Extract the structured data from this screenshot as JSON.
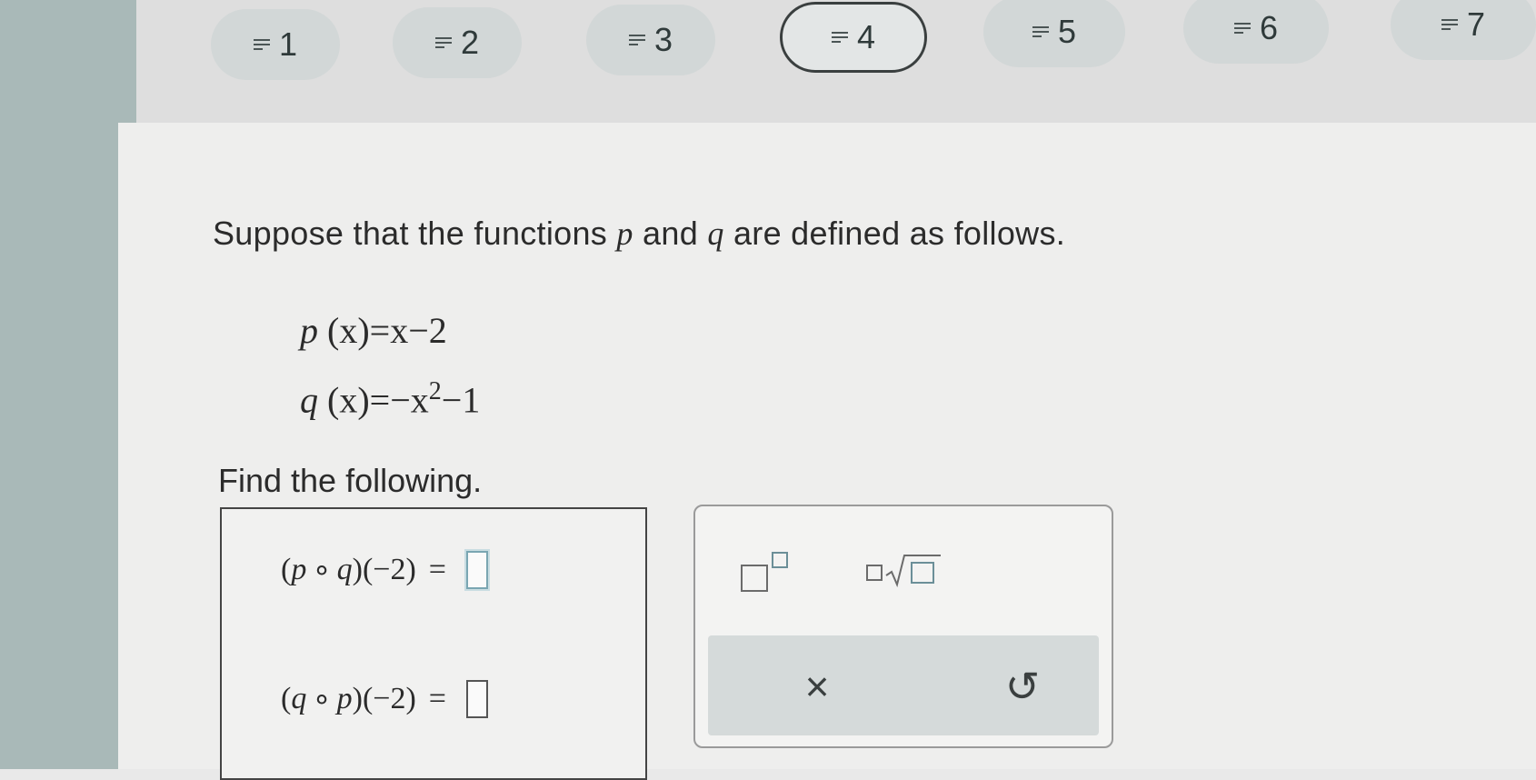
{
  "nav": {
    "questions": [
      {
        "label": "1",
        "active": false
      },
      {
        "label": "2",
        "active": false
      },
      {
        "label": "3",
        "active": false
      },
      {
        "label": "4",
        "active": true
      },
      {
        "label": "5",
        "active": false
      },
      {
        "label": "6",
        "active": false
      },
      {
        "label": "7",
        "active": false
      }
    ]
  },
  "problem": {
    "intro_prefix": "Suppose that the functions",
    "var_p": "p",
    "and": "and",
    "var_q": "q",
    "intro_suffix": "are defined as follows.",
    "p_def": {
      "name": "p",
      "arg": "(x)",
      "rhs": "=x−2"
    },
    "q_def": {
      "name": "q",
      "arg": "(x)",
      "rhs_start": "=−x",
      "exponent": "2",
      "rhs_end": "−1"
    },
    "find_label": "Find the following."
  },
  "answers": [
    {
      "open": "(",
      "f1": "p",
      "circ": "∘",
      "f2": "q",
      "close": ")",
      "arg": "(−2)",
      "eq": "="
    },
    {
      "open": "(",
      "f1": "q",
      "circ": "∘",
      "f2": "p",
      "close": ")",
      "arg": "(−2)",
      "eq": "="
    }
  ],
  "toolbox": {
    "tools": [
      "superscript-icon",
      "nth-root-icon"
    ],
    "actions": {
      "clear": "×",
      "undo": "↺"
    }
  }
}
